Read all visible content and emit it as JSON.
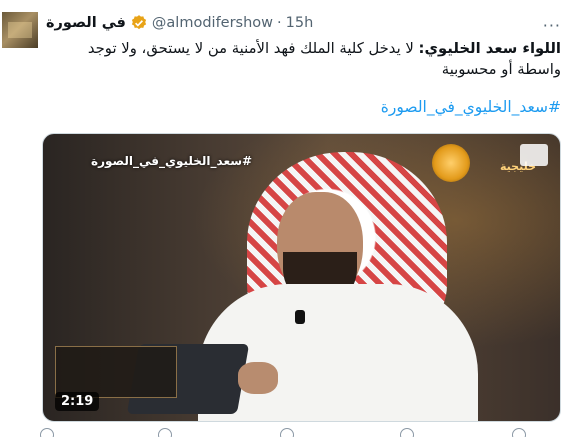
{
  "tweet": {
    "display_name": "في الصورة",
    "handle": "@almodifershow",
    "separator": "·",
    "time": "15h",
    "more_label": "···",
    "text_bold": "اللواء سعد الخليوي:",
    "text_body": " لا يدخل كلية الملك فهد الأمنية من لا يستحق، ولا توجد واسطة أو محسوبية",
    "hashtag": "#سعد_الخليوي_في_الصورة"
  },
  "media": {
    "overlay_text": "#سعد_الخليوي_في_الصورة",
    "channel_text": "خليجية",
    "duration": "2:19"
  },
  "colors": {
    "link": "#1d9bf0",
    "verified_badge": "#e8a317",
    "secondary_text": "#536471"
  },
  "icons": {
    "verified": "verified-badge-icon",
    "more": "more-icon",
    "expand": "expand-icon"
  }
}
